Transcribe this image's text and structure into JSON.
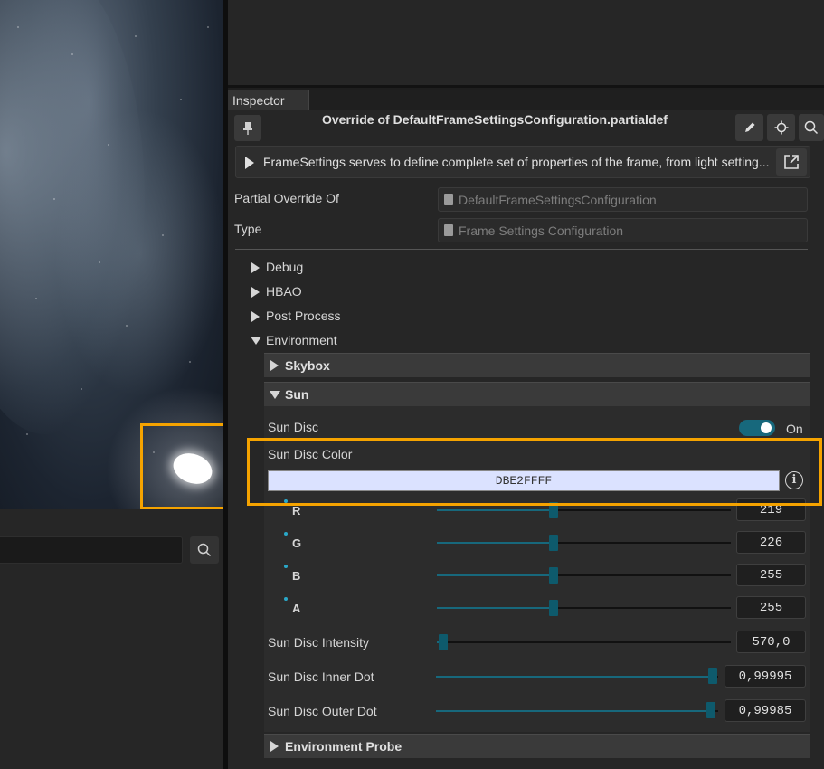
{
  "viewport_search": {
    "placeholder": ""
  },
  "inspector": {
    "tab_label": "Inspector",
    "title": "Override of DefaultFrameSettingsConfiguration.partialdef",
    "description": "FrameSettings serves to define complete set of properties of the frame, from light setting...",
    "partial_override_label": "Partial Override Of",
    "partial_override_value": "DefaultFrameSettingsConfiguration",
    "type_label": "Type",
    "type_value": "Frame Settings Configuration",
    "tree": [
      "Debug",
      "HBAO",
      "Post Process",
      "Environment"
    ],
    "sections": {
      "skybox": "Skybox",
      "sun": "Sun",
      "environment_probe": "Environment Probe"
    },
    "sun": {
      "sun_disc_label": "Sun Disc",
      "sun_disc_state": "On",
      "sun_disc_color_label": "Sun Disc Color",
      "sun_disc_color_value": "DBE2FFFF",
      "channels": [
        {
          "label": "R",
          "value": "219"
        },
        {
          "label": "G",
          "value": "226"
        },
        {
          "label": "B",
          "value": "255"
        },
        {
          "label": "A",
          "value": "255"
        }
      ],
      "intensity_label": "Sun Disc Intensity",
      "intensity_value": "570,0",
      "inner_dot_label": "Sun Disc Inner Dot",
      "inner_dot_value": "0,99995",
      "outer_dot_label": "Sun Disc Outer Dot",
      "outer_dot_value": "0,99985"
    }
  },
  "icons": [
    "pin-icon",
    "pencil-icon",
    "crosshair-icon",
    "search-icon",
    "external-link-icon",
    "info-icon",
    "document-icon"
  ],
  "colors": {
    "accent": "#17687c",
    "highlight": "#f5a300",
    "color_swatch": "#dbe2ff"
  }
}
